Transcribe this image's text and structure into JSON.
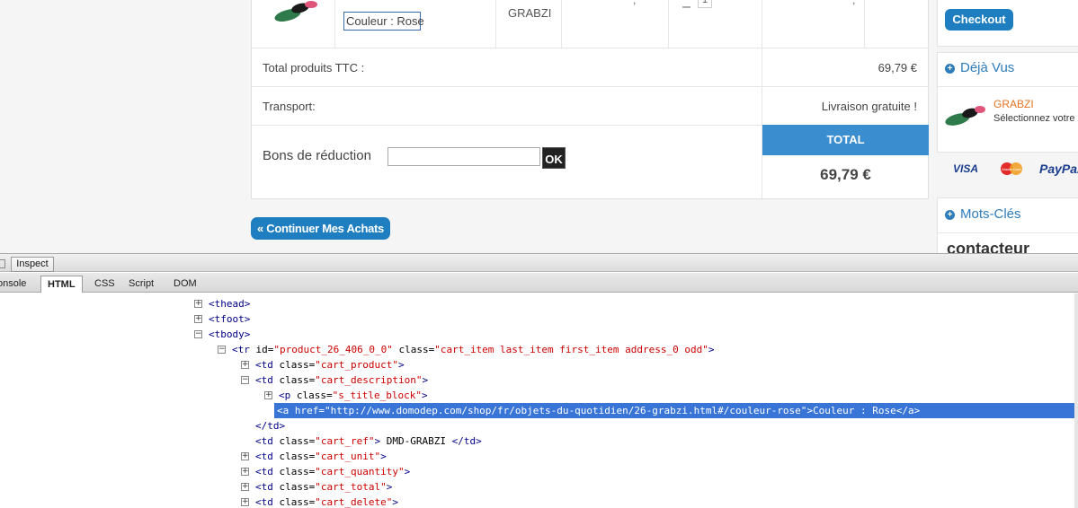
{
  "cart": {
    "colour_link": "Couleur : Rose",
    "ref": "GRABZI",
    "qty_minus": "–",
    "qty_value": "1",
    "comma": ",",
    "total_products_label": "Total produits TTC :",
    "total_products_value": "69,79 €",
    "transport_label": "Transport:",
    "transport_value": "Livraison gratuite !",
    "voucher_label": "Bons de réduction",
    "voucher_input_value": "",
    "voucher_ok": "OK",
    "total_header": "TOTAL",
    "total_amount": "69,79 €",
    "continue_button": "« Continuer Mes Achats"
  },
  "sidebar": {
    "checkout_button": "Checkout",
    "deja_vus_title": "Déjà Vus",
    "deja_item_name": "GRABZI",
    "deja_item_desc": "Sélectionnez votre",
    "mots_cles_title": "Mots-Clés",
    "mots_partial": "contacteur"
  },
  "payment": [
    "VISA",
    "MasterCard",
    "PayPal"
  ],
  "colors": {
    "accent": "#1f7ec0",
    "total_header": "#3a8ed0",
    "link_orange": "#e37222",
    "selection": "#3875d7"
  },
  "icons": {
    "plus": "plus-icon",
    "expand": "expand-icon",
    "collapse": "collapse-icon"
  },
  "devtools": {
    "inspect_button": "Inspect",
    "tabs": [
      "onsole",
      "HTML",
      "CSS",
      "Script",
      "DOM"
    ],
    "active_tab": "HTML",
    "tree": [
      {
        "t": "<thead>"
      },
      {
        "t": "<tfoot>"
      },
      {
        "t": "<tbody>"
      },
      {
        "t": "<tr"
      },
      {
        "a": "id",
        "v": "\"product_26_406_0_0\""
      },
      {
        "a": "class",
        "v": "\"cart_item last_item first_item address_0 odd\""
      },
      {
        "t": "<td"
      },
      {
        "a": "class",
        "v": "\"cart_product\""
      },
      {
        "a": "class",
        "v": "\"cart_description\""
      },
      {
        "t": "<p"
      },
      {
        "a": "class",
        "v": "\"s_title_block\""
      },
      {
        "a": "href",
        "v": "\"http://www.domodep.com/shop/fr/objets-du-quotidien/26-grabzi.html#/couleur-rose\""
      },
      {
        "txt": "Couleur : Rose"
      },
      {
        "t": "</a>"
      },
      {
        "t": "</td>"
      },
      {
        "a": "class",
        "v": "\"cart_ref\""
      },
      {
        "txt": "DMD-GRABZI"
      },
      {
        "a": "class",
        "v": "\"cart_unit\""
      },
      {
        "a": "class",
        "v": "\"cart_quantity\""
      },
      {
        "a": "class",
        "v": "\"cart_total\""
      },
      {
        "a": "class",
        "v": "\"cart_delete\""
      },
      {
        "t": "<a"
      }
    ]
  }
}
